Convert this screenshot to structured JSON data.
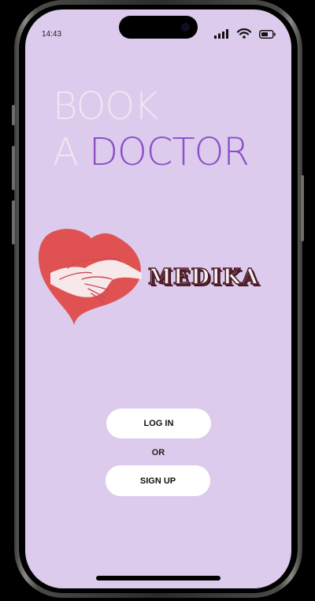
{
  "status_bar": {
    "time": "14:43",
    "icons": [
      "cellular-signal-icon",
      "wifi-icon",
      "battery-icon"
    ]
  },
  "hero": {
    "line1": "BOOK",
    "line2_prefix": "A ",
    "line2_highlight": "DOCTOR"
  },
  "logo": {
    "brand": "MEDIKA",
    "icon": "heart-hands-icon"
  },
  "actions": {
    "login_label": "LOG IN",
    "separator": "OR",
    "signup_label": "SIGN UP"
  },
  "colors": {
    "background": "#dccbec",
    "accent": "#8b4fc8",
    "heart": "#e05252",
    "button": "#ffffff"
  }
}
